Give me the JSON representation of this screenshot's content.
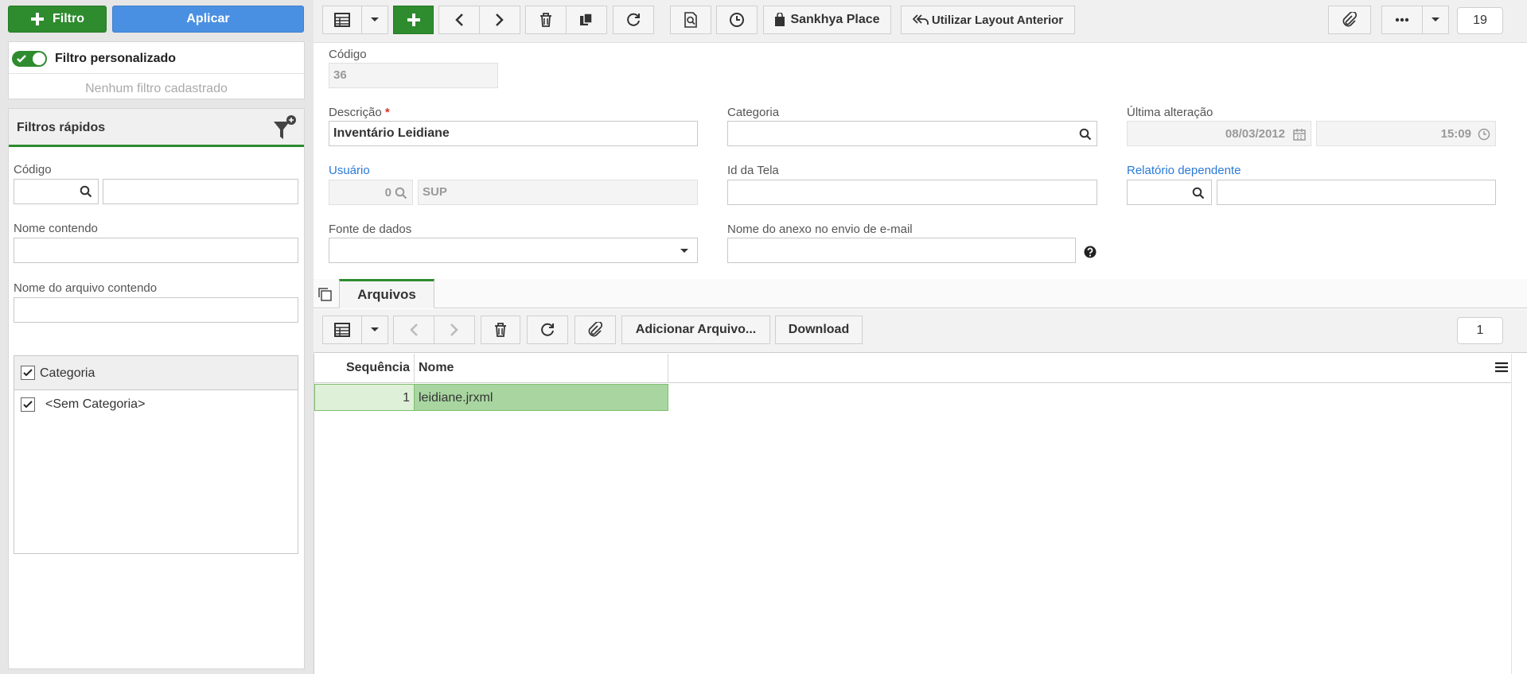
{
  "left": {
    "filter_button": "Filtro",
    "apply_button": "Aplicar",
    "custom_filter_label": "Filtro personalizado",
    "no_filter_text": "Nenhum filtro cadastrado",
    "quick_filters_title": "Filtros rápidos",
    "codigo_label": "Código",
    "nome_label": "Nome contendo",
    "arquivo_label": "Nome do arquivo contendo",
    "categoria_header": "Categoria",
    "categoria_items": [
      "<Sem Categoria>"
    ]
  },
  "toolbar": {
    "sankhya_place": "Sankhya Place",
    "layout_anterior": "Utilizar Layout Anterior",
    "record_count": "19"
  },
  "form": {
    "codigo_label": "Código",
    "codigo_value": "36",
    "descricao_label": "Descrição",
    "required_mark": "*",
    "descricao_value": "Inventário Leidiane",
    "categoria_label": "Categoria",
    "ultima_label": "Última alteração",
    "ultima_date": "08/03/2012",
    "ultima_time": "15:09",
    "usuario_label": "Usuário",
    "usuario_code": "0",
    "usuario_name": "SUP",
    "idtela_label": "Id da Tela",
    "relatorio_label": "Relatório dependente",
    "fonte_label": "Fonte de dados",
    "anexo_label": "Nome do anexo no envio de e-mail"
  },
  "tabs": {
    "arquivos": "Arquivos"
  },
  "subtoolbar": {
    "adicionar": "Adicionar Arquivo...",
    "download": "Download",
    "count": "1"
  },
  "grid": {
    "col_seq": "Sequência",
    "col_nome": "Nome",
    "rows": [
      {
        "seq": "1",
        "nome": "leidiane.jrxml"
      }
    ]
  },
  "colors": {
    "green": "#2e8b2e",
    "blue": "#4a90e2",
    "row_selected": "#a8d5a0"
  }
}
